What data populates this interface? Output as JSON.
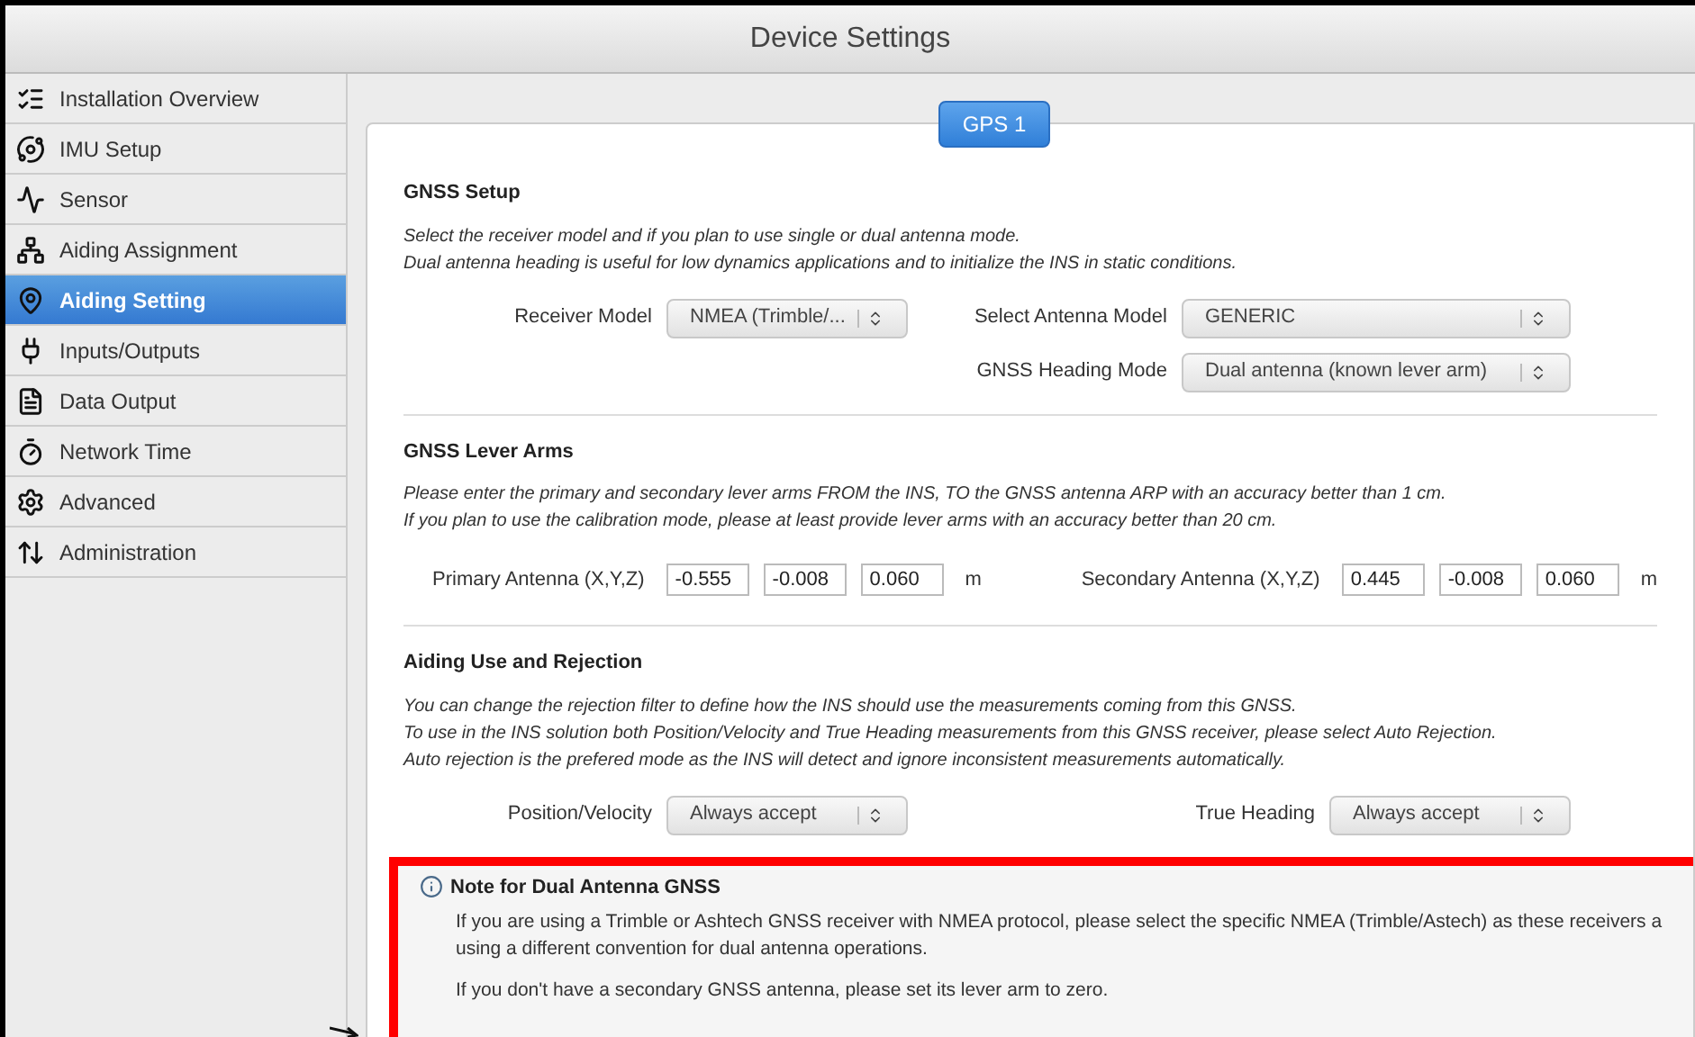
{
  "window": {
    "title": "Device Settings"
  },
  "sidebar": {
    "items": [
      {
        "label": "Installation Overview",
        "selected": false
      },
      {
        "label": "IMU Setup",
        "selected": false
      },
      {
        "label": "Sensor",
        "selected": false
      },
      {
        "label": "Aiding Assignment",
        "selected": false
      },
      {
        "label": "Aiding Setting",
        "selected": true
      },
      {
        "label": "Inputs/Outputs",
        "selected": false
      },
      {
        "label": "Data Output",
        "selected": false
      },
      {
        "label": "Network Time",
        "selected": false
      },
      {
        "label": "Advanced",
        "selected": false
      },
      {
        "label": "Administration",
        "selected": false
      }
    ]
  },
  "tabs": [
    {
      "label": "GPS 1",
      "selected": true
    }
  ],
  "sections": [
    {
      "title": "GNSS Setup",
      "lines": [
        "Select the receiver model and if you plan to use single or dual antenna mode.",
        "Dual antenna heading is useful for low dynamics applications and to initialize the INS in static conditions."
      ],
      "kind": "selects",
      "rows": [
        [
          {
            "label": "Receiver Model",
            "value": "NMEA (Trimble/..."
          },
          {
            "label": "Select Antenna Model",
            "value": "GENERIC"
          }
        ],
        [
          null,
          {
            "label": "GNSS Heading Mode",
            "value": "Dual antenna (known lever arm)"
          }
        ]
      ]
    },
    {
      "title": "GNSS Lever Arms",
      "lines": [
        "Please enter the primary and secondary lever arms FROM the INS, TO the GNSS antenna ARP with an accuracy better than 1 cm.",
        "If you plan to use the calibration mode, please at least provide lever arms with an accuracy better than 20 cm."
      ],
      "kind": "vectors",
      "groups": [
        {
          "label": "Primary Antenna (X,Y,Z)",
          "values": [
            "-0.555",
            "-0.008",
            "0.060"
          ],
          "unit": "m"
        },
        {
          "label": "Secondary Antenna (X,Y,Z)",
          "values": [
            "0.445",
            "-0.008",
            "0.060"
          ],
          "unit": "m"
        }
      ]
    },
    {
      "title": "Aiding Use and Rejection",
      "lines": [
        "You can change the rejection filter to define how the INS should use the measurements coming from this GNSS.",
        "To use in the INS solution both Position/Velocity and True Heading measurements from this GNSS receiver, please select Auto Rejection.",
        "Auto rejection is the prefered mode as the INS will detect and ignore inconsistent measurements automatically."
      ],
      "kind": "selects",
      "rows": [
        [
          {
            "label": "Position/Velocity",
            "value": "Always accept"
          },
          {
            "label": "True Heading",
            "value": "Always accept"
          }
        ]
      ]
    }
  ],
  "note": {
    "title": "Note for Dual Antenna GNSS",
    "paragraphs": [
      [
        "If you are using a Trimble or Ashtech GNSS receiver with NMEA protocol, please select the specific NMEA (Trimble/Astech) as these receivers a",
        "using a different convention for dual antenna operations."
      ],
      [
        "If you don't have a secondary GNSS antenna, please set its lever arm to zero."
      ]
    ]
  }
}
